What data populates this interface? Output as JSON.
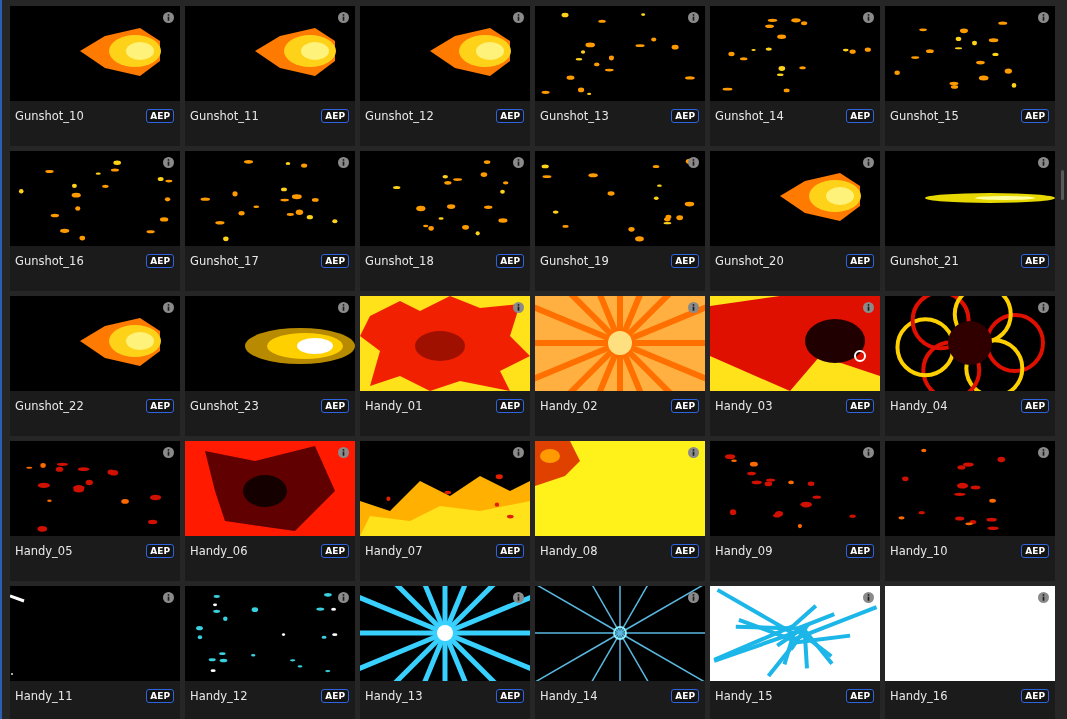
{
  "assets": [
    {
      "name": "Gunshot_10",
      "format": "AEP",
      "kind": "picture"
    },
    {
      "name": "Gunshot_11",
      "format": "AEP",
      "kind": "picture"
    },
    {
      "name": "Gunshot_12",
      "format": "AEP",
      "kind": "picture"
    },
    {
      "name": "Gunshot_13",
      "format": "AEP",
      "kind": "picture"
    },
    {
      "name": "Gunshot_14",
      "format": "AEP",
      "kind": "picture"
    },
    {
      "name": "Gunshot_15",
      "format": "AEP",
      "kind": "picture"
    },
    {
      "name": "Gunshot_16",
      "format": "AEP",
      "kind": "picture"
    },
    {
      "name": "Gunshot_17",
      "format": "AEP",
      "kind": "picture"
    },
    {
      "name": "Gunshot_18",
      "format": "AEP",
      "kind": "picture"
    },
    {
      "name": "Gunshot_19",
      "format": "AEP",
      "kind": "picture"
    },
    {
      "name": "Gunshot_20",
      "format": "AEP",
      "kind": "picture"
    },
    {
      "name": "Gunshot_21",
      "format": "AEP",
      "kind": "picture"
    },
    {
      "name": "Gunshot_22",
      "format": "AEP",
      "kind": "picture"
    },
    {
      "name": "Gunshot_23",
      "format": "AEP",
      "kind": "picture"
    },
    {
      "name": "Handy_01",
      "format": "AEP",
      "kind": "picture"
    },
    {
      "name": "Handy_02",
      "format": "AEP",
      "kind": "picture"
    },
    {
      "name": "Handy_03",
      "format": "AEP",
      "kind": "picture"
    },
    {
      "name": "Handy_04",
      "format": "AEP",
      "kind": "picture"
    },
    {
      "name": "Handy_05",
      "format": "AEP",
      "kind": "picture"
    },
    {
      "name": "Handy_06",
      "format": "AEP",
      "kind": "picture"
    },
    {
      "name": "Handy_07",
      "format": "AEP",
      "kind": "picture"
    },
    {
      "name": "Handy_08",
      "format": "AEP",
      "kind": "picture"
    },
    {
      "name": "Handy_09",
      "format": "AEP",
      "kind": "picture"
    },
    {
      "name": "Handy_10",
      "format": "AEP",
      "kind": "picture"
    },
    {
      "name": "Handy_11",
      "format": "AEP",
      "kind": "picture"
    },
    {
      "name": "Handy_12",
      "format": "AEP",
      "kind": "picture"
    },
    {
      "name": "Handy_13",
      "format": "AEP",
      "kind": "picture"
    },
    {
      "name": "Handy_14",
      "format": "AEP",
      "kind": "picture"
    },
    {
      "name": "Handy_15",
      "format": "AEP",
      "kind": "picture"
    },
    {
      "name": "Handy_16",
      "format": "AEP",
      "kind": "picture"
    }
  ]
}
